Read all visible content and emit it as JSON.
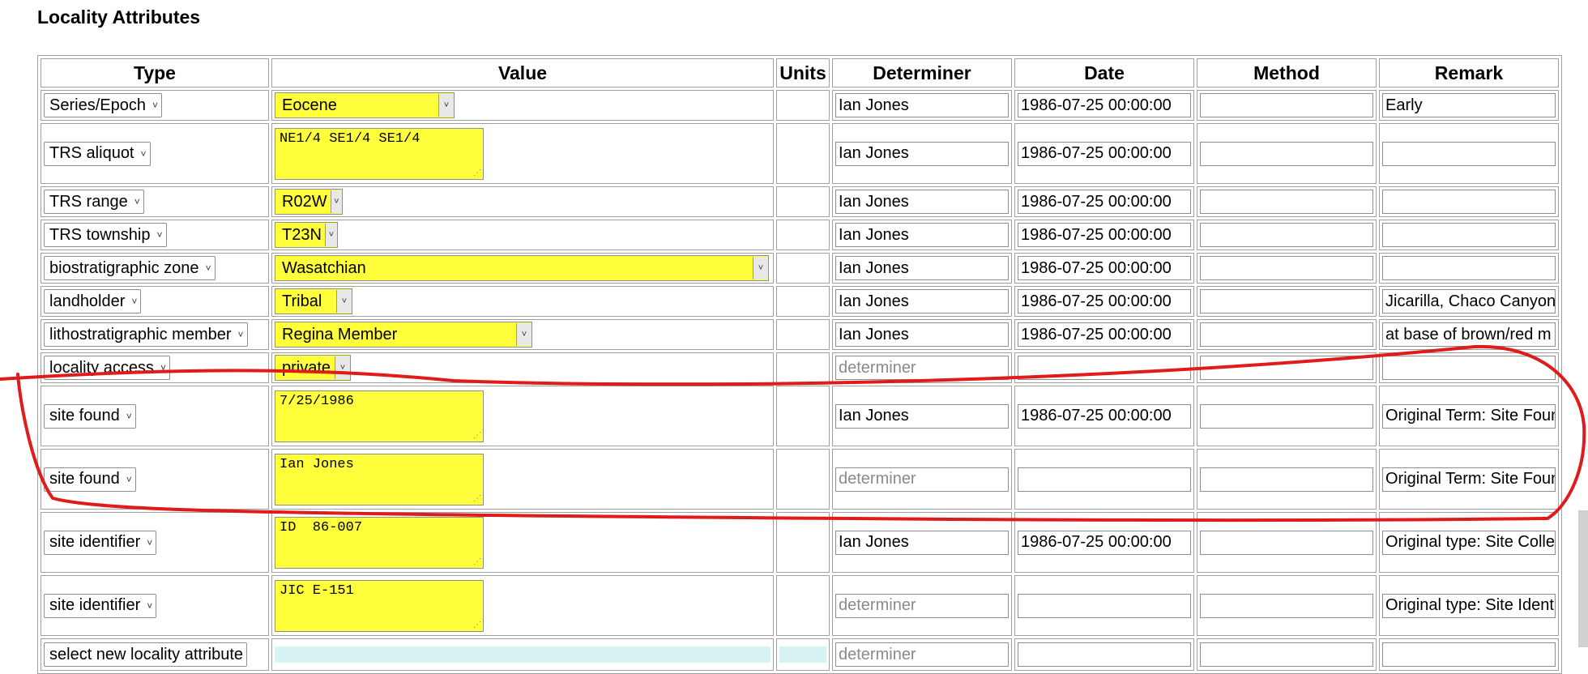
{
  "page_title": "Locality Attributes",
  "columns": [
    "Type",
    "Value",
    "Units",
    "Determiner",
    "Date",
    "Method",
    "Remark"
  ],
  "rows": [
    {
      "type": "Series/Epoch",
      "value_kind": "select",
      "value": "Eocene",
      "determiner": "Ian Jones",
      "determiner_placeholder": false,
      "date": "1986-07-25 00:00:00",
      "method": "",
      "remark": "Early"
    },
    {
      "type": "TRS aliquot",
      "value_kind": "textarea",
      "value": "NE1/4 SE1/4 SE1/4",
      "determiner": "Ian Jones",
      "determiner_placeholder": false,
      "date": "1986-07-25 00:00:00",
      "method": "",
      "remark": ""
    },
    {
      "type": "TRS range",
      "value_kind": "select",
      "value": "R02W",
      "determiner": "Ian Jones",
      "determiner_placeholder": false,
      "date": "1986-07-25 00:00:00",
      "method": "",
      "remark": ""
    },
    {
      "type": "TRS township",
      "value_kind": "select",
      "value": "T23N",
      "determiner": "Ian Jones",
      "determiner_placeholder": false,
      "date": "1986-07-25 00:00:00",
      "method": "",
      "remark": ""
    },
    {
      "type": "biostratigraphic zone",
      "value_kind": "select",
      "value": "Wasatchian",
      "determiner": "Ian Jones",
      "determiner_placeholder": false,
      "date": "1986-07-25 00:00:00",
      "method": "",
      "remark": ""
    },
    {
      "type": "landholder",
      "value_kind": "select",
      "value": "Tribal",
      "determiner": "Ian Jones",
      "determiner_placeholder": false,
      "date": "1986-07-25 00:00:00",
      "method": "",
      "remark": "Jicarilla, Chaco Canyon"
    },
    {
      "type": "lithostratigraphic member",
      "value_kind": "select",
      "value": "Regina Member",
      "determiner": "Ian Jones",
      "determiner_placeholder": false,
      "date": "1986-07-25 00:00:00",
      "method": "",
      "remark": "at base of brown/red m"
    },
    {
      "type": "locality access",
      "value_kind": "select",
      "value": "private",
      "determiner": "determiner",
      "determiner_placeholder": true,
      "date": "",
      "method": "",
      "remark": ""
    },
    {
      "type": "site found",
      "value_kind": "textarea",
      "value": "7/25/1986",
      "determiner": "Ian Jones",
      "determiner_placeholder": false,
      "date": "1986-07-25 00:00:00",
      "method": "",
      "remark": "Original Term: Site Foun"
    },
    {
      "type": "site found",
      "value_kind": "textarea",
      "value": "Ian Jones",
      "determiner": "determiner",
      "determiner_placeholder": true,
      "date": "",
      "method": "",
      "remark": "Original Term: Site Foun"
    },
    {
      "type": "site identifier",
      "value_kind": "textarea",
      "value": "ID  86-007",
      "determiner": "Ian Jones",
      "determiner_placeholder": false,
      "date": "1986-07-25 00:00:00",
      "method": "",
      "remark": "Original type: Site Colle"
    },
    {
      "type": "site identifier",
      "value_kind": "textarea",
      "value": "JIC E-151",
      "determiner": "determiner",
      "determiner_placeholder": true,
      "date": "",
      "method": "",
      "remark": "Original type: Site Ident"
    }
  ],
  "new_row": {
    "type": "select new locality attribute",
    "determiner": "determiner"
  },
  "colors": {
    "highlight": "#ffff3c",
    "annotation": "#e01b1b",
    "new_row_fill": "#d8f3f3"
  }
}
